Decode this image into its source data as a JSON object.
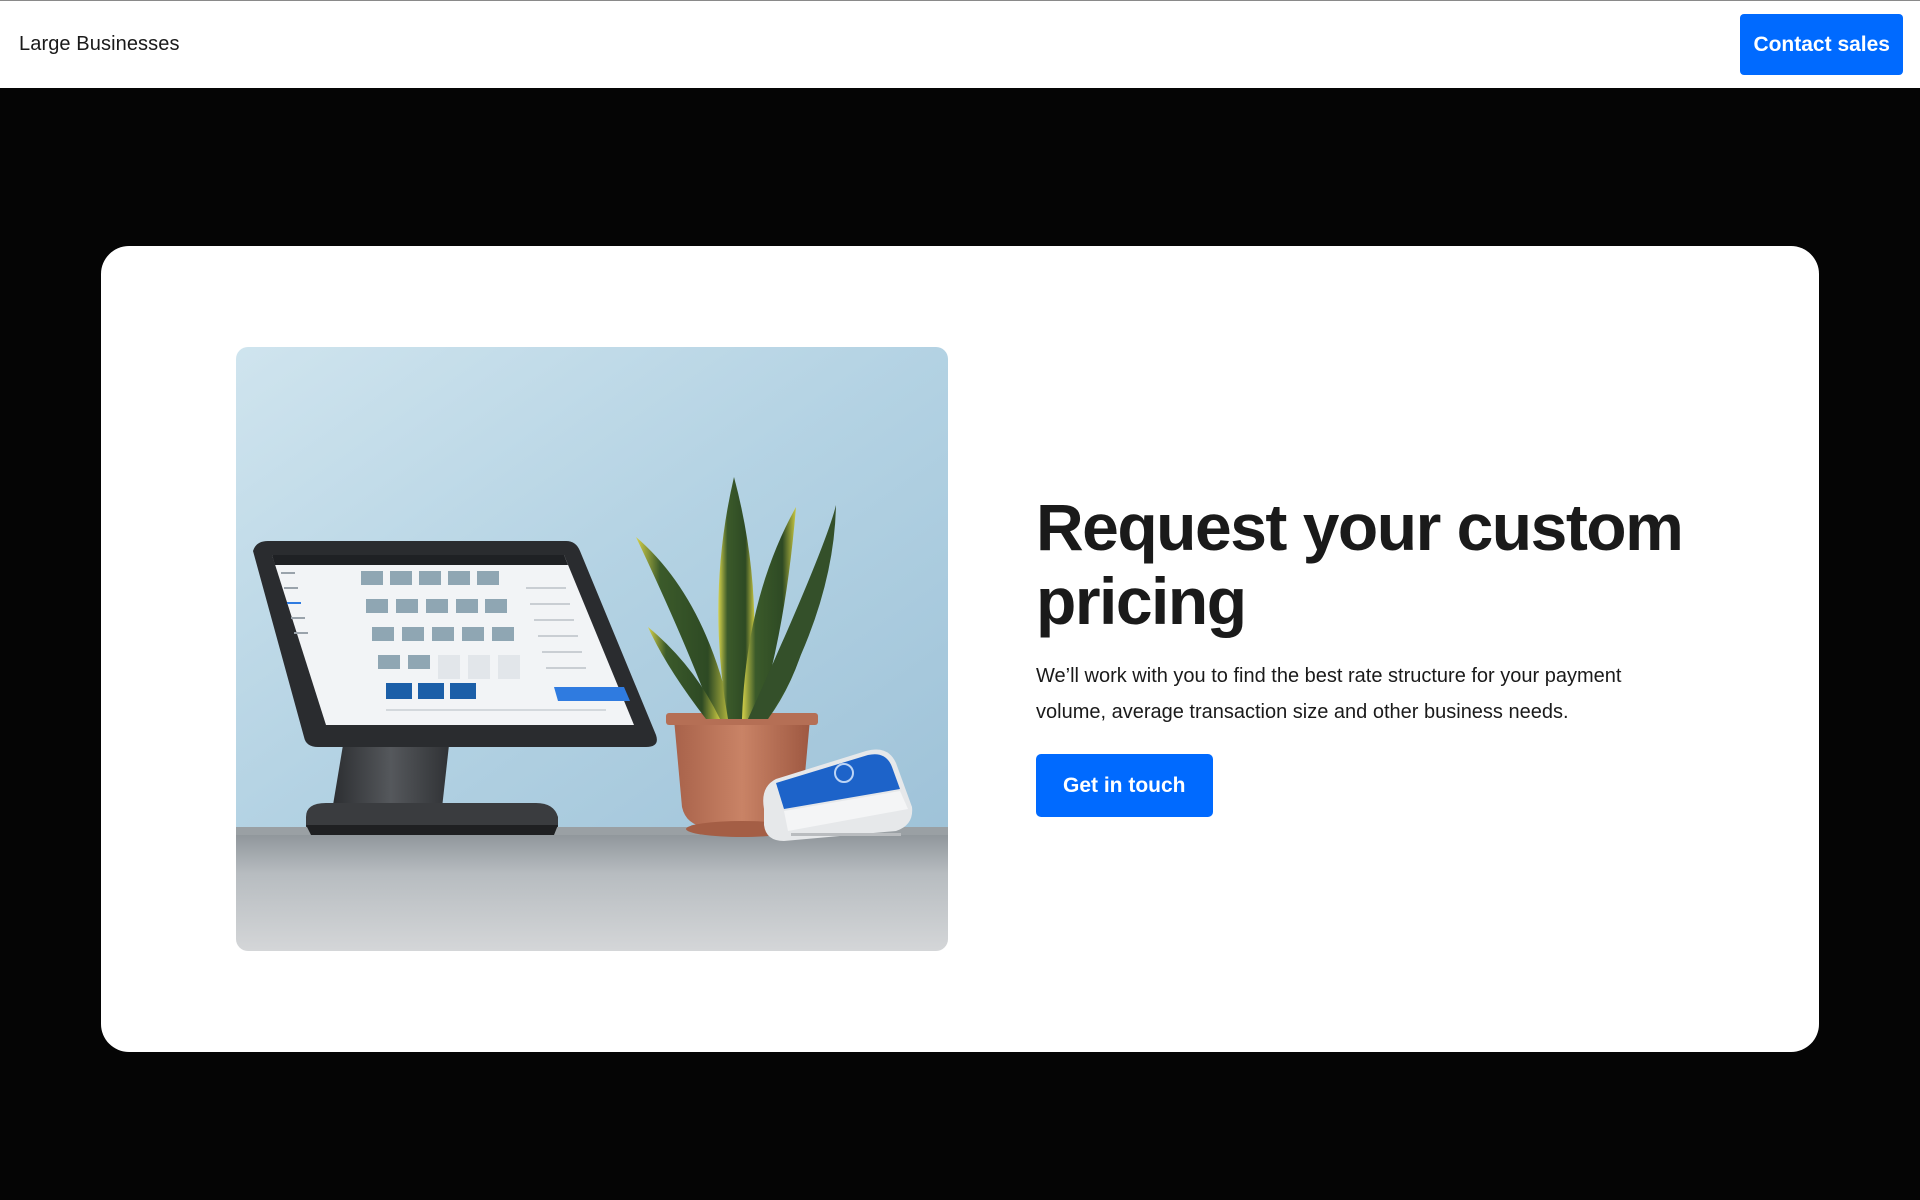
{
  "header": {
    "brand_label": "Large Businesses",
    "contact_label": "Contact sales"
  },
  "hero": {
    "headline_line1": "Request your custom",
    "headline_line2": "pricing",
    "subcopy": "We’ll work with you to find the best rate structure for your payment volume, average transaction size and other business needs.",
    "cta_label": "Get in touch",
    "image_icon": "pos-terminal-with-plant-image"
  },
  "colors": {
    "accent": "#006aff",
    "page_background": "#050505",
    "card_background": "#ffffff",
    "text": "#1a1a1a"
  }
}
